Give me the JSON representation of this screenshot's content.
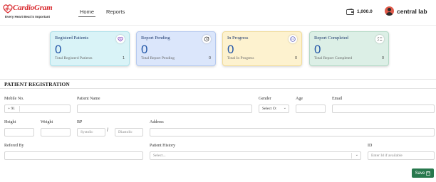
{
  "brand": {
    "name": "CardioGram",
    "tagline": "Every Heart Beat is Important"
  },
  "nav": {
    "home": "Home",
    "reports": "Reports"
  },
  "wallet": {
    "amount": "1,000.0"
  },
  "user": {
    "lab_name": "central lab"
  },
  "cards": [
    {
      "title": "Registerd Patients",
      "value": "0",
      "subtitle": "Total Registerd Patients",
      "count": "1",
      "bg": "#d9f3f7",
      "border": "#aee1ea",
      "icon": "heart-monitor-icon"
    },
    {
      "title": "Report Pending",
      "value": "0",
      "subtitle": "Total Report Pending",
      "count": "0",
      "bg": "#dbe6fb",
      "border": "#b5c9ef",
      "icon": "clock-refresh-icon"
    },
    {
      "title": "In Progress",
      "value": "0",
      "subtitle": "Total In Progress",
      "count": "0",
      "bg": "#fdf2cf",
      "border": "#f1dc9a",
      "icon": "more-dots-icon"
    },
    {
      "title": "Report Completed",
      "value": "0",
      "subtitle": "Total Report Completed",
      "count": "0",
      "bg": "#dcefe6",
      "border": "#b4d9c6",
      "icon": "checklist-icon"
    }
  ],
  "form": {
    "title": "PATIENT REGISTRATION",
    "mobile": {
      "label": "Mobile No.",
      "prefix": "+ 91"
    },
    "patient_name": {
      "label": "Patient Name"
    },
    "gender": {
      "label": "Gender",
      "value": "Select O:"
    },
    "age": {
      "label": "Age"
    },
    "email": {
      "label": "Email"
    },
    "height": {
      "label": "Height"
    },
    "weight": {
      "label": "Weight"
    },
    "bp": {
      "label": "BP",
      "systolic": "Systolic",
      "diastolic": "Diastolic",
      "separator": "/"
    },
    "address": {
      "label": "Address"
    },
    "referred_by": {
      "label": "Refered By"
    },
    "patient_history": {
      "label": "Patient History",
      "placeholder": "Select..."
    },
    "id": {
      "label": "ID",
      "placeholder": "Enter Id if available"
    },
    "save_label": "Save"
  }
}
